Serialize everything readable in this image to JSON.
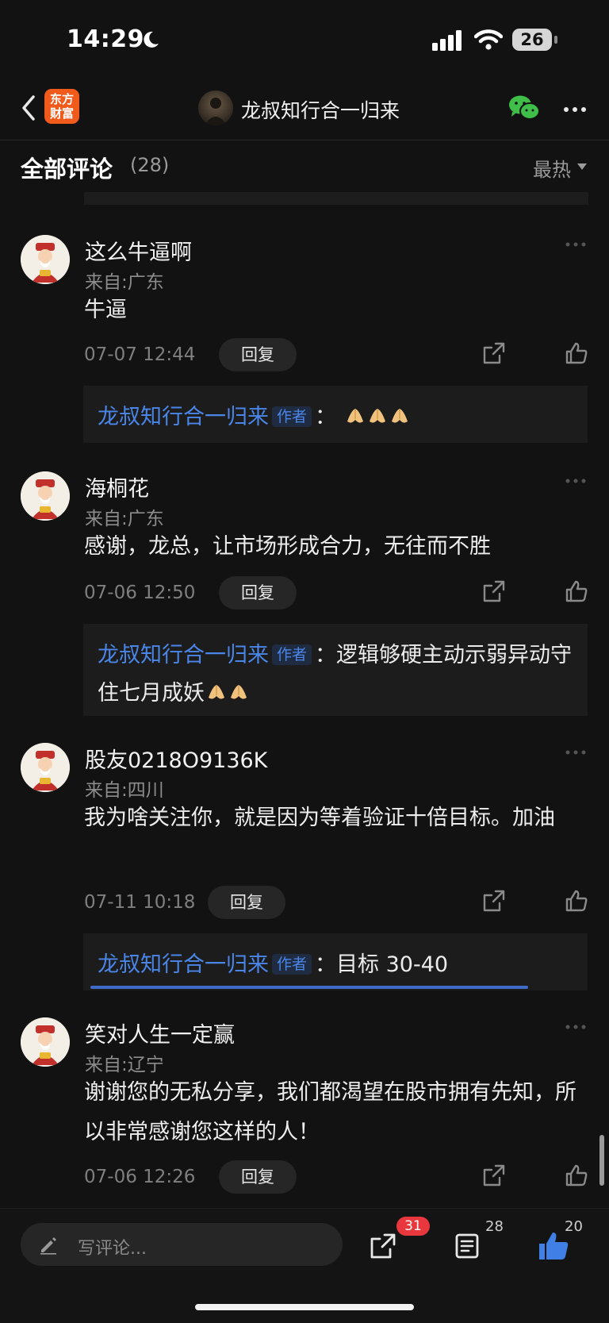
{
  "status_bar": {
    "time": "14:29",
    "battery": "26"
  },
  "nav": {
    "app_logo_line1": "东方",
    "app_logo_line2": "财富",
    "title": "龙叔知行合一归来"
  },
  "comments_header": {
    "title": "全部评论",
    "count": "(28)",
    "sort": "最热"
  },
  "comments": [
    {
      "username": "这么牛逼啊",
      "location": "来自:广东",
      "text": "牛逼",
      "date": "07-07 12:44",
      "reply_label": "回复",
      "reply": {
        "author": "龙叔知行合一归来",
        "tag": "作者",
        "text": "：",
        "emoji_count": 3
      }
    },
    {
      "username": "海桐花",
      "location": "来自:广东",
      "text": "感谢，龙总，让市场形成合力，无往而不胜",
      "date": "07-06 12:50",
      "reply_label": "回复",
      "reply": {
        "author": "龙叔知行合一归来",
        "tag": "作者",
        "text": "：逻辑够硬主动示弱异动守住七月成妖",
        "emoji_count": 2
      }
    },
    {
      "username": "股友0218O9136K",
      "location": "来自:四川",
      "text": "我为啥关注你，就是因为等着验证十倍目标。加油",
      "date": "07-11 10:18",
      "reply_label": "回复",
      "reply": {
        "author": "龙叔知行合一归来",
        "tag": "作者",
        "text": "：目标 30-40",
        "emoji_count": 0
      }
    },
    {
      "username": "笑对人生一定赢",
      "location": "来自:辽宁",
      "text": "谢谢您的无私分享，我们都渴望在股市拥有先知，所以非常感谢您这样的人！",
      "date": "07-06 12:26",
      "reply_label": "回复"
    }
  ],
  "bottom_bar": {
    "placeholder": "写评论...",
    "share_badge": "31",
    "comment_count": "28",
    "like_count": "20"
  },
  "colors": {
    "accent_blue": "#4a86e8",
    "badge_red": "#e8383d",
    "logo_orange": "#f05a1a",
    "background": "#121212"
  }
}
